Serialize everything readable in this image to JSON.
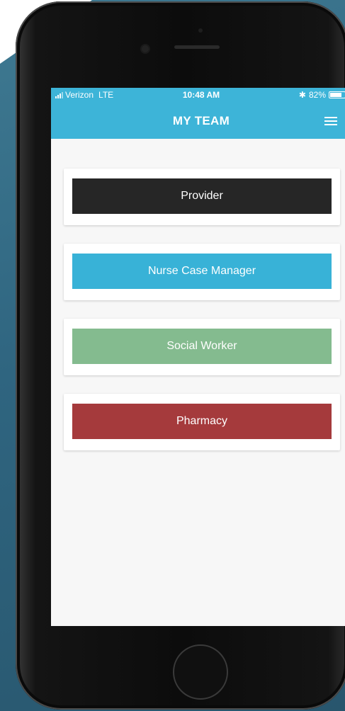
{
  "status_bar": {
    "carrier": "Verizon",
    "network": "LTE",
    "time": "10:48 AM",
    "bluetooth_icon": "bluetooth-icon",
    "battery_text": "82%",
    "battery_level": 0.82
  },
  "nav": {
    "title": "MY TEAM",
    "menu_icon": "hamburger-menu-icon"
  },
  "team": [
    {
      "label": "Provider",
      "color": "#262626"
    },
    {
      "label": "Nurse Case Manager",
      "color": "#38b2d7"
    },
    {
      "label": "Social Worker",
      "color": "#84bb8f"
    },
    {
      "label": "Pharmacy",
      "color": "#a53a3c"
    }
  ],
  "colors": {
    "header": "#3db4d8",
    "screen_bg": "#f7f7f7"
  }
}
